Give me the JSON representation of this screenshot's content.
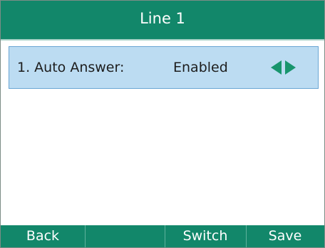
{
  "title": "Line 1",
  "setting": {
    "label": "1. Auto Answer:",
    "value": "Enabled"
  },
  "icons": {
    "left_arrow": "left-arrow",
    "right_arrow": "right-arrow"
  },
  "softkeys": [
    "Back",
    "",
    "Switch",
    "Save"
  ],
  "colors": {
    "bar": "#12876a",
    "highlight": "#bcdcf2",
    "arrow": "#17956d"
  }
}
